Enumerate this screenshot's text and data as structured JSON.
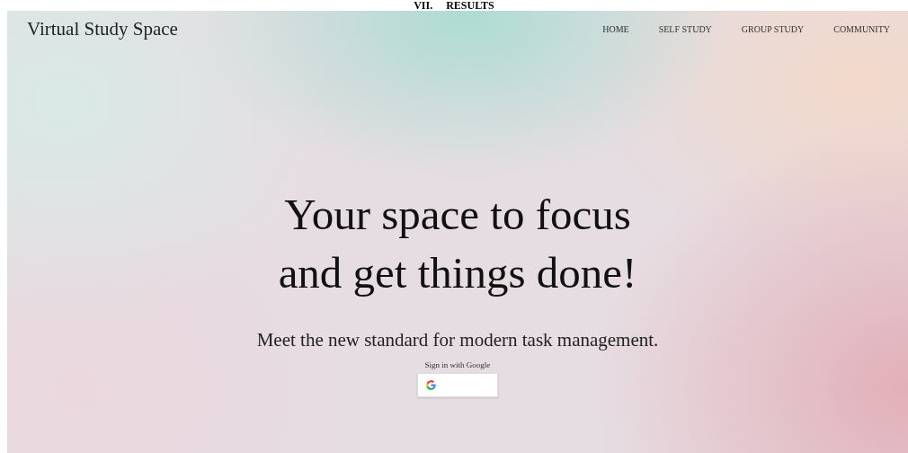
{
  "document_heading": "VII.     RESULTS",
  "site_title": "Virtual Study Space",
  "nav": [
    {
      "label": "HOME"
    },
    {
      "label": "SELF STUDY"
    },
    {
      "label": "GROUP STUDY"
    },
    {
      "label": "COMMUNITY"
    }
  ],
  "hero": {
    "headline_lines": [
      "Your space to focus",
      "and get things done!"
    ],
    "subtitle": "Meet the new standard for modern task management.",
    "sign_in_label": "Sign in with Google"
  }
}
